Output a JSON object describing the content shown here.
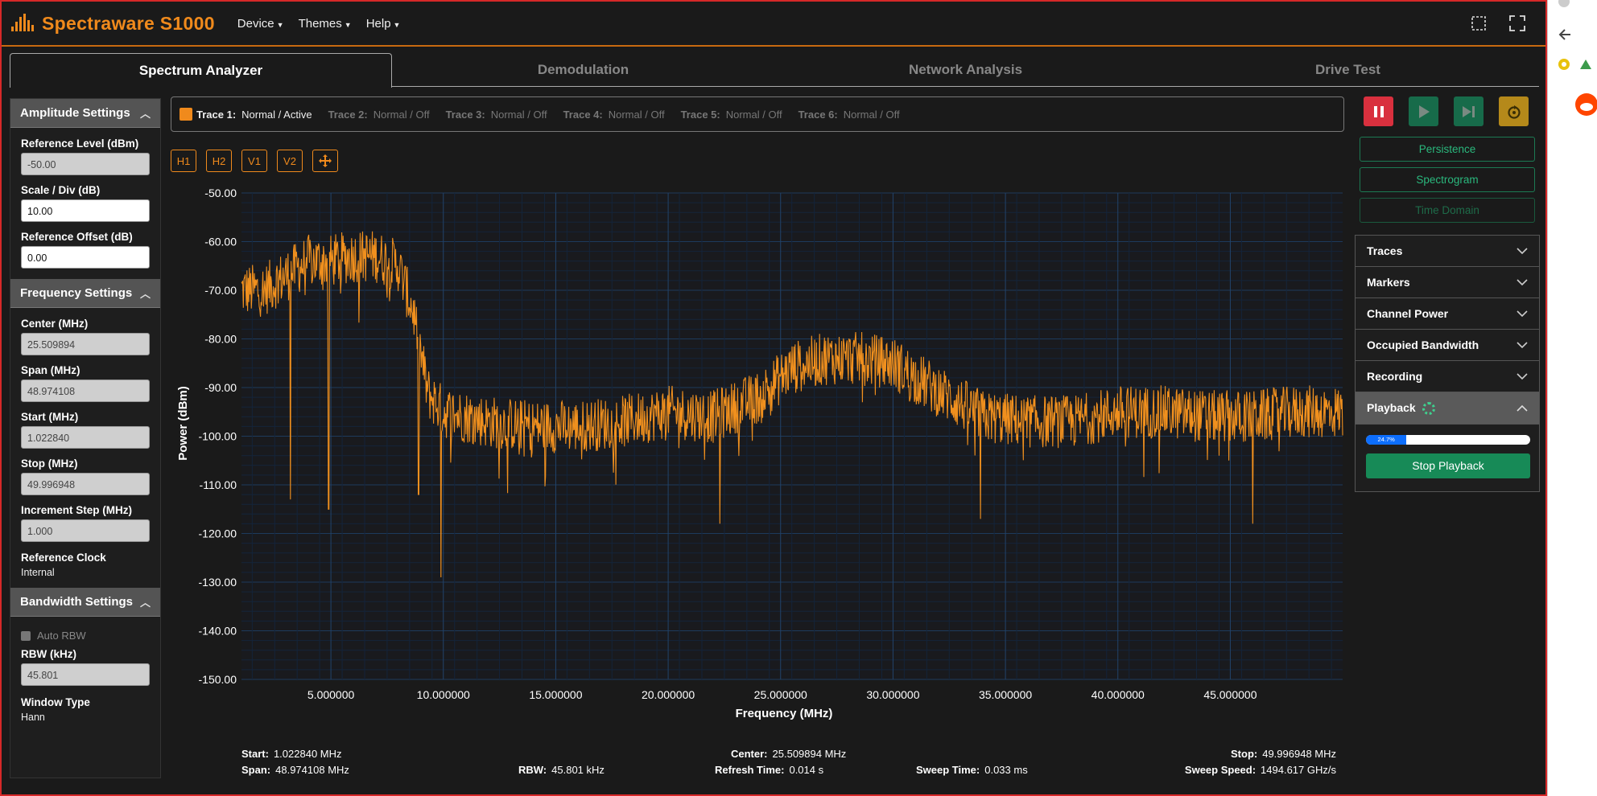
{
  "brand": "Spectraware S1000",
  "menu": [
    "Device",
    "Themes",
    "Help"
  ],
  "tabs": [
    "Spectrum Analyzer",
    "Demodulation",
    "Network Analysis",
    "Drive Test"
  ],
  "sidebar": {
    "amplitude": {
      "title": "Amplitude Settings",
      "ref_level_label": "Reference Level (dBm)",
      "ref_level": "-50.00",
      "scale_label": "Scale / Div (dB)",
      "scale": "10.00",
      "offset_label": "Reference Offset (dB)",
      "offset": "0.00"
    },
    "frequency": {
      "title": "Frequency Settings",
      "center_label": "Center (MHz)",
      "center": "25.509894",
      "span_label": "Span (MHz)",
      "span": "48.974108",
      "start_label": "Start (MHz)",
      "start": "1.022840",
      "stop_label": "Stop (MHz)",
      "stop": "49.996948",
      "step_label": "Increment Step (MHz)",
      "step": "1.000",
      "clock_label": "Reference Clock",
      "clock": "Internal"
    },
    "bandwidth": {
      "title": "Bandwidth Settings",
      "auto_rbw": "Auto RBW",
      "rbw_label": "RBW (kHz)",
      "rbw": "45.801",
      "window_label": "Window Type",
      "window": "Hann"
    }
  },
  "traces": [
    {
      "name": "Trace 1:",
      "status": "Normal / Active"
    },
    {
      "name": "Trace 2:",
      "status": "Normal / Off"
    },
    {
      "name": "Trace 3:",
      "status": "Normal / Off"
    },
    {
      "name": "Trace 4:",
      "status": "Normal / Off"
    },
    {
      "name": "Trace 5:",
      "status": "Normal / Off"
    },
    {
      "name": "Trace 6:",
      "status": "Normal / Off"
    }
  ],
  "marker_buttons": [
    "H1",
    "H2",
    "V1",
    "V2"
  ],
  "stats": {
    "start_label": "Start:",
    "start": "1.022840 MHz",
    "center_label": "Center:",
    "center": "25.509894 MHz",
    "stop_label": "Stop:",
    "stop": "49.996948 MHz",
    "span_label": "Span:",
    "span": "48.974108 MHz",
    "rbw_label": "RBW:",
    "rbw": "45.801 kHz",
    "refresh_label": "Refresh Time:",
    "refresh": "0.014 s",
    "sweep_label": "Sweep Time:",
    "sweep": "0.033 ms",
    "speed_label": "Sweep Speed:",
    "speed": "1494.617 GHz/s"
  },
  "side_buttons": {
    "persistence": "Persistence",
    "spectrogram": "Spectrogram",
    "time_domain": "Time Domain"
  },
  "accordion": [
    "Traces",
    "Markers",
    "Channel Power",
    "Occupied Bandwidth",
    "Recording"
  ],
  "playback": {
    "title": "Playback",
    "progress_label": "24.7%",
    "progress": 0.247,
    "stop_label": "Stop Playback"
  },
  "colors": {
    "accent": "#f08a1c",
    "trace": "#f0901e",
    "grid": "#1a3555",
    "stop": "#178a57",
    "pause": "#d9303e"
  },
  "chart_data": {
    "type": "line",
    "xlabel": "Frequency (MHz)",
    "ylabel": "Power (dBm)",
    "xlim": [
      1.02284,
      49.996948
    ],
    "ylim": [
      -150,
      -50
    ],
    "xticks": [
      "5.000000",
      "10.000000",
      "15.000000",
      "20.000000",
      "25.000000",
      "30.000000",
      "35.000000",
      "40.000000",
      "45.000000"
    ],
    "yticks": [
      "-50.00",
      "-60.00",
      "-70.00",
      "-80.00",
      "-90.00",
      "-100.00",
      "-110.00",
      "-120.00",
      "-130.00",
      "-140.00",
      "-150.00"
    ],
    "grid": true,
    "series": [
      {
        "color": "#f0901e",
        "envelope": {
          "x": [
            1.02,
            2,
            3,
            4,
            5,
            6,
            7,
            8,
            8.7,
            9.3,
            10,
            12,
            14,
            16,
            18,
            20,
            22,
            24,
            25.5,
            27,
            28.5,
            30,
            31,
            32.5,
            34,
            36,
            38,
            40,
            42,
            44,
            46,
            48,
            50
          ],
          "y": [
            -70,
            -70,
            -67,
            -64,
            -64,
            -63,
            -63,
            -65,
            -75,
            -91,
            -95,
            -97,
            -98,
            -98,
            -97,
            -95,
            -96,
            -92,
            -86,
            -84,
            -84,
            -85,
            -88,
            -92,
            -96,
            -97,
            -97,
            -95,
            -95,
            -96,
            -96,
            -95,
            -95
          ]
        },
        "spikes": [
          {
            "x": 3.2,
            "y": -113
          },
          {
            "x": 4.9,
            "y": -115
          },
          {
            "x": 8.9,
            "y": -112
          },
          {
            "x": 9.9,
            "y": -129
          },
          {
            "x": 22.3,
            "y": -118
          },
          {
            "x": 33.9,
            "y": -117
          },
          {
            "x": 46.0,
            "y": -118
          }
        ]
      }
    ]
  }
}
